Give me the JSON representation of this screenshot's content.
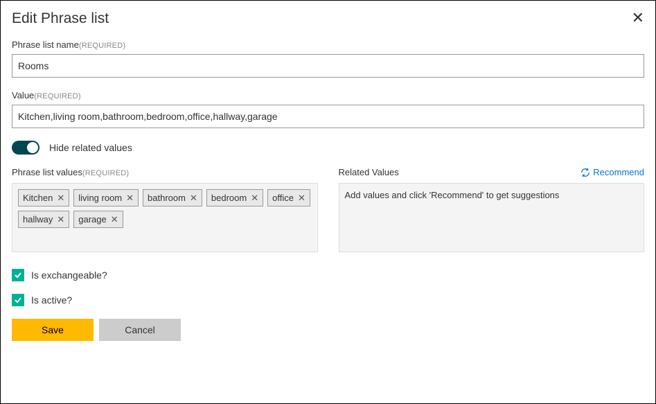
{
  "title": "Edit Phrase list",
  "name_field": {
    "label": "Phrase list name",
    "required_text": "(REQUIRED)",
    "value": "Rooms"
  },
  "value_field": {
    "label": "Value",
    "required_text": "(REQUIRED)",
    "value": "Kitchen,living room,bathroom,bedroom,office,hallway,garage"
  },
  "toggle": {
    "label": "Hide related values",
    "on": true
  },
  "phrase_values": {
    "label": "Phrase list values",
    "required_text": "(REQUIRED)",
    "tags": [
      "Kitchen",
      "living room",
      "bathroom",
      "bedroom",
      "office",
      "hallway",
      "garage"
    ]
  },
  "related": {
    "label": "Related Values",
    "recommend_label": "Recommend",
    "placeholder": "Add values and click 'Recommend' to get suggestions"
  },
  "checkboxes": {
    "exchangeable": {
      "label": "Is exchangeable?",
      "checked": true
    },
    "active": {
      "label": "Is active?",
      "checked": true
    }
  },
  "buttons": {
    "save": "Save",
    "cancel": "Cancel"
  }
}
